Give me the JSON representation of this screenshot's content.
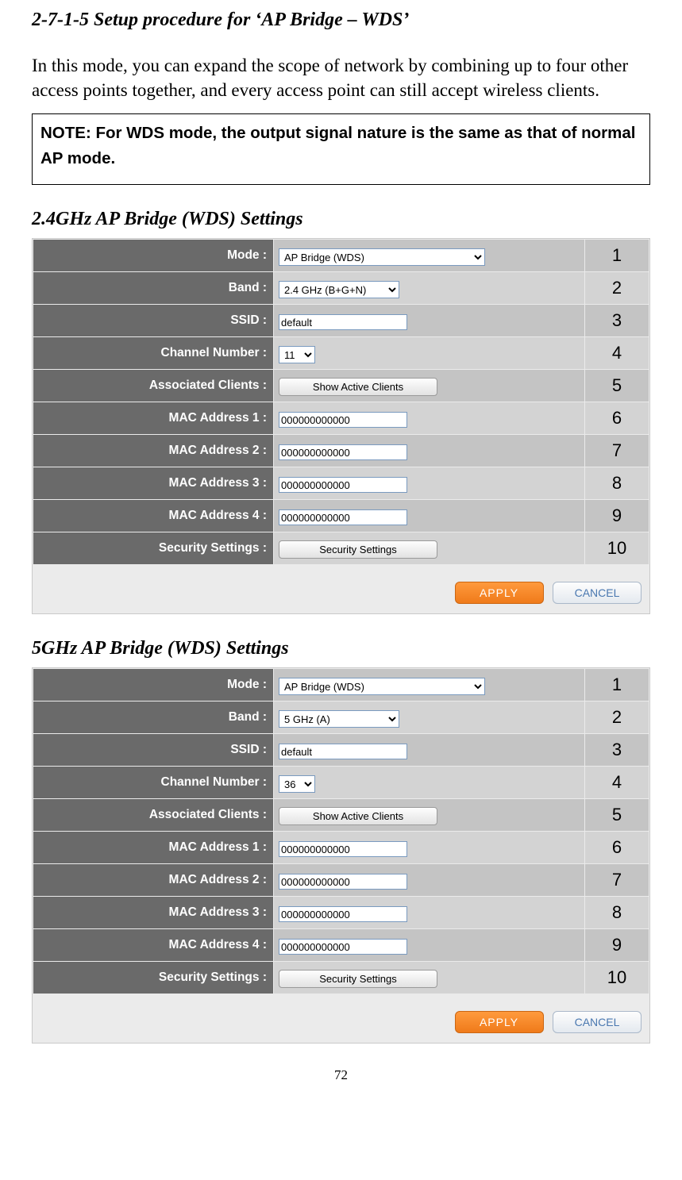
{
  "heading": "2-7-1-5 Setup procedure for ‘AP Bridge – WDS’",
  "intro": "In this mode, you can expand the scope of network by combining up to four other access points together, and every access point can still accept wireless clients.",
  "note": "NOTE: For WDS mode, the output signal nature is the same as that of normal AP mode.",
  "section24_title": "2.4GHz AP Bridge (WDS) Settings",
  "section5_title": "5GHz AP Bridge (WDS) Settings",
  "labels": {
    "mode": "Mode :",
    "band": "Band :",
    "ssid": "SSID :",
    "channel": "Channel Number :",
    "clients": "Associated Clients :",
    "mac1": "MAC Address 1 :",
    "mac2": "MAC Address 2 :",
    "mac3": "MAC Address 3 :",
    "mac4": "MAC Address 4 :",
    "security": "Security Settings :"
  },
  "panel24": {
    "mode": "AP Bridge (WDS)",
    "band": "2.4 GHz (B+G+N)",
    "ssid": "default",
    "channel": "11",
    "clients_btn": "Show Active Clients",
    "mac1": "000000000000",
    "mac2": "000000000000",
    "mac3": "000000000000",
    "mac4": "000000000000",
    "security_btn": "Security Settings"
  },
  "panel5": {
    "mode": "AP Bridge (WDS)",
    "band": "5 GHz (A)",
    "ssid": "default",
    "channel": "36",
    "clients_btn": "Show Active Clients",
    "mac1": "000000000000",
    "mac2": "000000000000",
    "mac3": "000000000000",
    "mac4": "000000000000",
    "security_btn": "Security Settings"
  },
  "annotations": [
    "1",
    "2",
    "3",
    "4",
    "5",
    "6",
    "7",
    "8",
    "9",
    "10"
  ],
  "buttons": {
    "apply": "APPLY",
    "cancel": "CANCEL"
  },
  "page_number": "72"
}
